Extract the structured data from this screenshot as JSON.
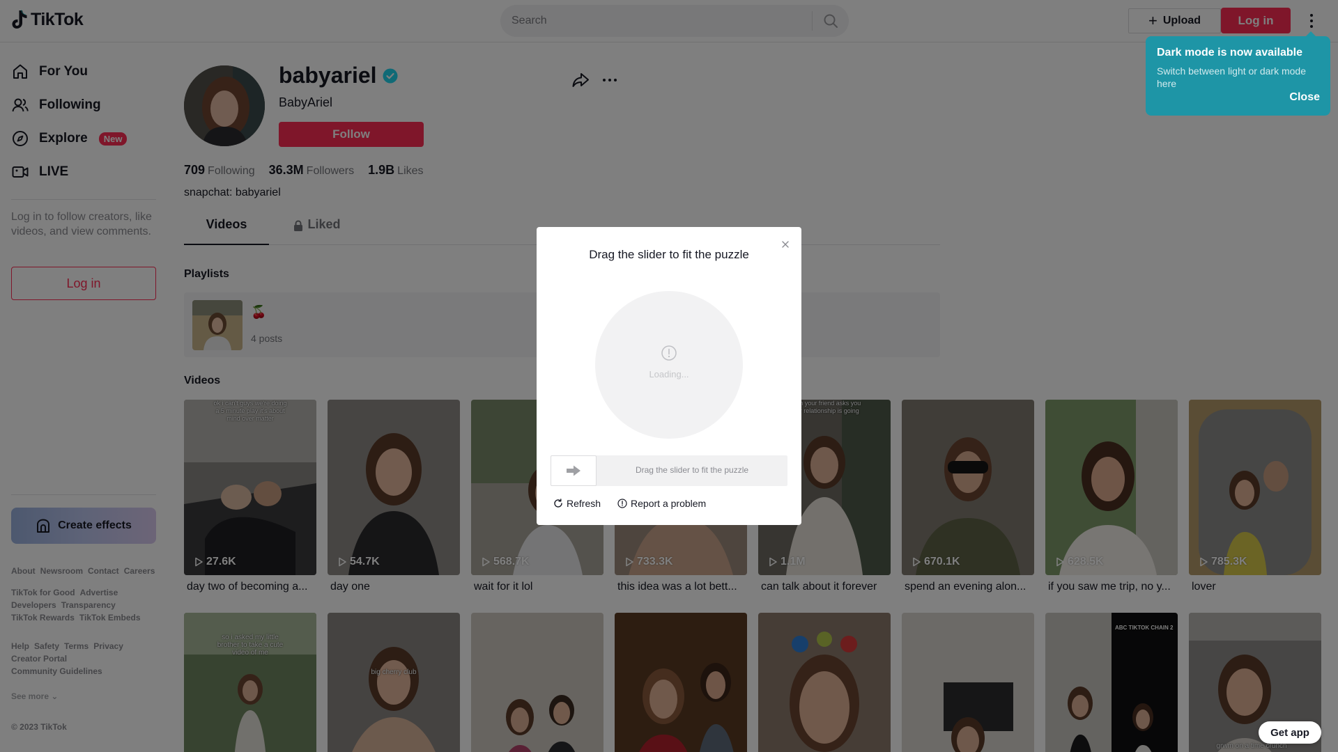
{
  "header": {
    "logo_text": "TikTok",
    "search_placeholder": "Search",
    "upload_label": "Upload",
    "login_label": "Log in"
  },
  "toast": {
    "title": "Dark mode is now available",
    "body": "Switch between light or dark mode here",
    "close_label": "Close"
  },
  "sidebar": {
    "nav": [
      {
        "label": "For You",
        "icon": "home-icon"
      },
      {
        "label": "Following",
        "icon": "users-icon"
      },
      {
        "label": "Explore",
        "icon": "compass-icon",
        "badge": "New"
      },
      {
        "label": "LIVE",
        "icon": "live-icon"
      }
    ],
    "login_prompt": "Log in to follow creators, like videos, and view comments.",
    "login_label": "Log in",
    "create_effects_label": "Create effects",
    "footer_row1": [
      "About",
      "Newsroom",
      "Contact",
      "Careers"
    ],
    "footer_row2": [
      "TikTok for Good",
      "Advertise",
      "Developers",
      "Transparency",
      "TikTok Rewards",
      "TikTok Embeds"
    ],
    "footer_row3": [
      "Help",
      "Safety",
      "Terms",
      "Privacy",
      "Creator Portal",
      "Community Guidelines"
    ],
    "see_more": "See more",
    "copyright": "© 2023 TikTok"
  },
  "profile": {
    "username": "babyariel",
    "nickname": "BabyAriel",
    "follow_label": "Follow",
    "following_count": "709",
    "following_label": "Following",
    "followers_count": "36.3M",
    "followers_label": "Followers",
    "likes_count": "1.9B",
    "likes_label": "Likes",
    "bio": "snapchat: babyariel"
  },
  "tabs": {
    "videos": "Videos",
    "liked": "Liked"
  },
  "playlists": {
    "title": "Playlists",
    "items": [
      {
        "name": "🍒",
        "count": "4 posts"
      }
    ]
  },
  "videos": {
    "title": "Videos",
    "row1": [
      {
        "views": "27.6K",
        "title": "day two of becoming a..."
      },
      {
        "views": "54.7K",
        "title": "day one"
      },
      {
        "views": "568.7K",
        "title": "wait for it lol"
      },
      {
        "views": "733.3K",
        "title": "this idea was a lot bett..."
      },
      {
        "views": "1.1M",
        "title": "can talk about it forever"
      },
      {
        "views": "670.1K",
        "title": "spend an evening alon..."
      },
      {
        "views": "628.5K",
        "title": "if you saw me trip, no y..."
      },
      {
        "views": "785.3K",
        "title": "lover"
      }
    ],
    "row1_overlay_1": "ok i can't guys we're doing a 5 minute play it's about mind over matter",
    "row1_overlay_5": "when your friend asks you your relationship is going",
    "row2_overlay_1": "so i asked my little brother to take a cute video of me",
    "row2_overlay_2": "big cherry club",
    "row2_overlay_7": "ABC TIKTOK CHAIN 2",
    "row2_overlay_8": "grwm on a time crunch"
  },
  "captcha": {
    "title": "Drag the slider to fit the puzzle",
    "loading": "Loading...",
    "slider_hint": "Drag the slider to fit the puzzle",
    "refresh_label": "Refresh",
    "report_label": "Report a problem"
  },
  "get_app_label": "Get app"
}
